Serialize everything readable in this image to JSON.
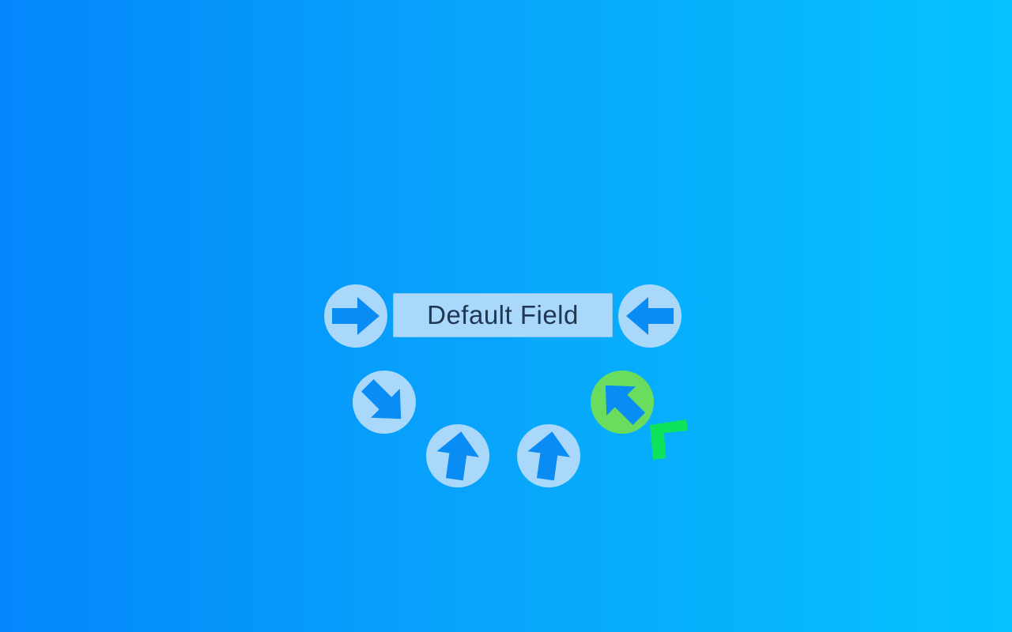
{
  "field": {
    "text": "Default Field"
  },
  "buttons": [
    {
      "id": "right",
      "icon": "arrow-right-icon",
      "state": "idle"
    },
    {
      "id": "left",
      "icon": "arrow-left-icon",
      "state": "idle"
    },
    {
      "id": "down-right",
      "icon": "arrow-down-right-icon",
      "state": "idle"
    },
    {
      "id": "up-left",
      "icon": "arrow-up-left-icon",
      "state": "selected"
    },
    {
      "id": "up-1",
      "icon": "arrow-up-icon",
      "state": "idle"
    },
    {
      "id": "up-2",
      "icon": "arrow-up-icon",
      "state": "idle"
    }
  ],
  "colors": {
    "background_left": "#0487fb",
    "background_right": "#05c2fe",
    "button_fill": "#a9d8fb",
    "button_active_fill": "#6bdd5e",
    "arrow_fill": "#0a8cf5",
    "cursor": "#0ee35c",
    "field_text": "#1f3752"
  }
}
